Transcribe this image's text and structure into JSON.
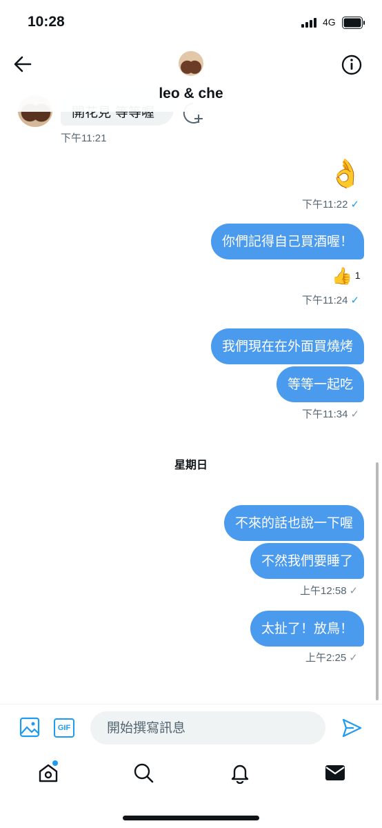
{
  "status_bar": {
    "time": "10:28",
    "network": "4G"
  },
  "header": {
    "title": "leo & che"
  },
  "messages": {
    "received": {
      "text": "開花見 等等喔",
      "time": "下午11:21"
    },
    "sent": [
      {
        "time": "下午11:22",
        "emoji": "👌"
      },
      {
        "text": "你們記得自己買酒喔！",
        "reaction_emoji": "👍",
        "reaction_count": "1",
        "time": "下午11:24"
      },
      {
        "text": "我們現在在外面買燒烤"
      },
      {
        "text": "等等一起吃",
        "time": "下午11:34"
      }
    ],
    "day_divider": "星期日",
    "sent_sunday": [
      {
        "text": "不來的話也說一下喔"
      },
      {
        "text": "不然我們要睡了",
        "time": "上午12:58"
      },
      {
        "text": "太扯了！放鳥！",
        "time": "上午2:25"
      }
    ]
  },
  "composer": {
    "placeholder": "開始撰寫訊息",
    "gif_label": "GIF"
  },
  "icons": {
    "back": "arrow-left-icon",
    "info": "info-icon",
    "image": "image-icon",
    "gif": "gif-icon",
    "send": "send-icon",
    "home": "home-icon",
    "search": "search-icon",
    "notifications": "bell-icon",
    "messages": "mail-icon"
  },
  "colors": {
    "accent": "#1d9bf0",
    "sent_bubble": "#4a9aee",
    "received_bubble": "#eff3f4"
  }
}
